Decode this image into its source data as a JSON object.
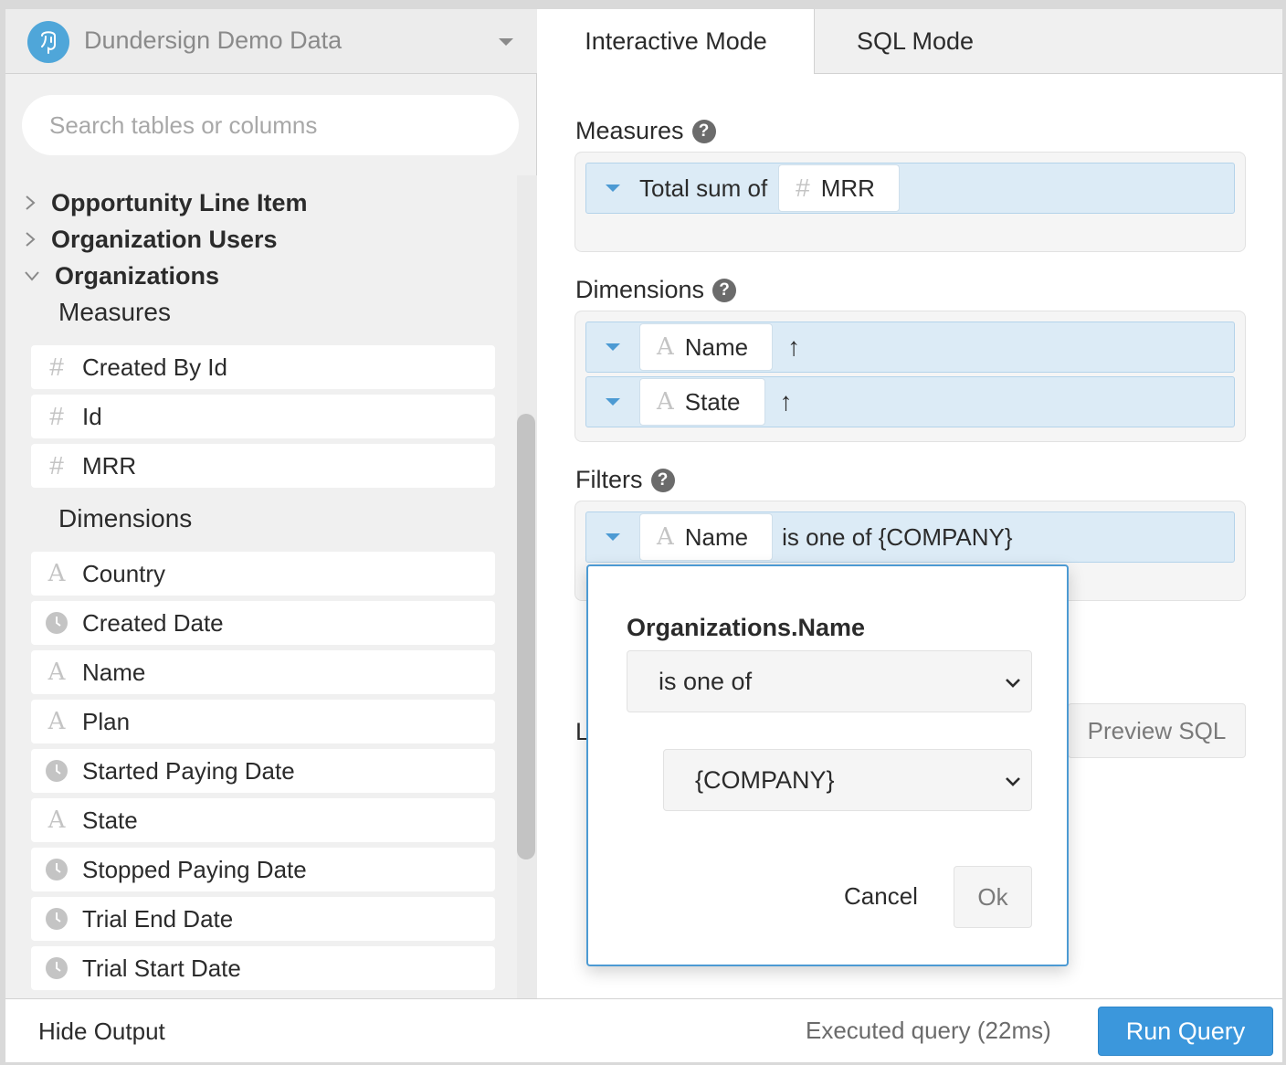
{
  "datasource": {
    "name": "Dundersign Demo Data",
    "logo_icon": "postgres-elephant-icon"
  },
  "search": {
    "placeholder": "Search tables or columns"
  },
  "tree": {
    "tables": [
      {
        "label": "Opportunity Line Item",
        "expanded": false
      },
      {
        "label": "Organization Users",
        "expanded": false
      },
      {
        "label": "Organizations",
        "expanded": true
      }
    ],
    "measures_title": "Measures",
    "measures": [
      {
        "label": "Created By Id",
        "icon": "hash-icon"
      },
      {
        "label": "Id",
        "icon": "hash-icon"
      },
      {
        "label": "MRR",
        "icon": "hash-icon"
      }
    ],
    "dimensions_title": "Dimensions",
    "dimensions": [
      {
        "label": "Country",
        "icon": "text-icon"
      },
      {
        "label": "Created Date",
        "icon": "clock-icon"
      },
      {
        "label": "Name",
        "icon": "text-icon"
      },
      {
        "label": "Plan",
        "icon": "text-icon"
      },
      {
        "label": "Started Paying Date",
        "icon": "clock-icon"
      },
      {
        "label": "State",
        "icon": "text-icon"
      },
      {
        "label": "Stopped Paying Date",
        "icon": "clock-icon"
      },
      {
        "label": "Trial End Date",
        "icon": "clock-icon"
      },
      {
        "label": "Trial Start Date",
        "icon": "clock-icon"
      }
    ]
  },
  "tabs": {
    "interactive": "Interactive Mode",
    "sql": "SQL Mode"
  },
  "builder": {
    "measures_label": "Measures",
    "measure": {
      "prefix": "Total sum of",
      "field": "MRR"
    },
    "dimensions_label": "Dimensions",
    "dimensions": [
      {
        "field": "Name",
        "sort": "↑"
      },
      {
        "field": "State",
        "sort": "↑"
      }
    ],
    "filters_label": "Filters",
    "filter": {
      "field": "Name",
      "condition": "is one of {COMPANY}"
    },
    "hidden_label_letter": "L",
    "preview_sql": "Preview SQL"
  },
  "popover": {
    "title": "Organizations.Name",
    "operator": "is one of",
    "value": "{COMPANY}",
    "cancel": "Cancel",
    "ok": "Ok"
  },
  "bottom": {
    "hide_output": "Hide Output",
    "status": "Executed query (22ms)",
    "run_query": "Run Query"
  },
  "colors": {
    "accent": "#3b97dc",
    "pill_bg": "#dcebf6",
    "popover_border": "#4c9ad3"
  }
}
